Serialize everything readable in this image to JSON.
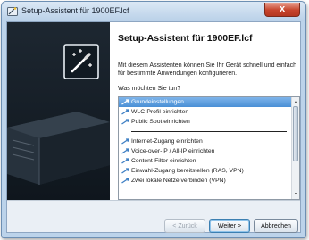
{
  "window": {
    "title": "Setup-Assistent für 1900EF.lcf",
    "close_label": "x"
  },
  "page": {
    "heading": "Setup-Assistent für 1900EF.lcf",
    "description": "Mit diesem Assistenten können Sie Ihr Gerät schnell und einfach für bestimmte Anwendungen konfigurieren.",
    "question": "Was möchten Sie tun?"
  },
  "options": {
    "group1": [
      {
        "label": "Grundeinstellungen",
        "selected": true
      },
      {
        "label": "WLC-Profil einrichten",
        "selected": false
      },
      {
        "label": "Public Spot einrichten",
        "selected": false
      }
    ],
    "group2": [
      {
        "label": "Internet-Zugang einrichten",
        "selected": false
      },
      {
        "label": "Voice-over-IP / All-IP einrichten",
        "selected": false
      },
      {
        "label": "Content-Filter einrichten",
        "selected": false
      },
      {
        "label": "Einwahl-Zugang bereitstellen (RAS, VPN)",
        "selected": false
      },
      {
        "label": "Zwei lokale Netze verbinden (VPN)",
        "selected": false
      }
    ]
  },
  "buttons": {
    "back": "< Zurück",
    "next": "Weiter >",
    "cancel": "Abbrechen"
  },
  "colors": {
    "accent": "#4a8fd6",
    "arrow": "#3d7fc4",
    "close": "#c7452c"
  },
  "icons": {
    "option": "arrow-icon",
    "graphic": "wizard-device-icon"
  }
}
